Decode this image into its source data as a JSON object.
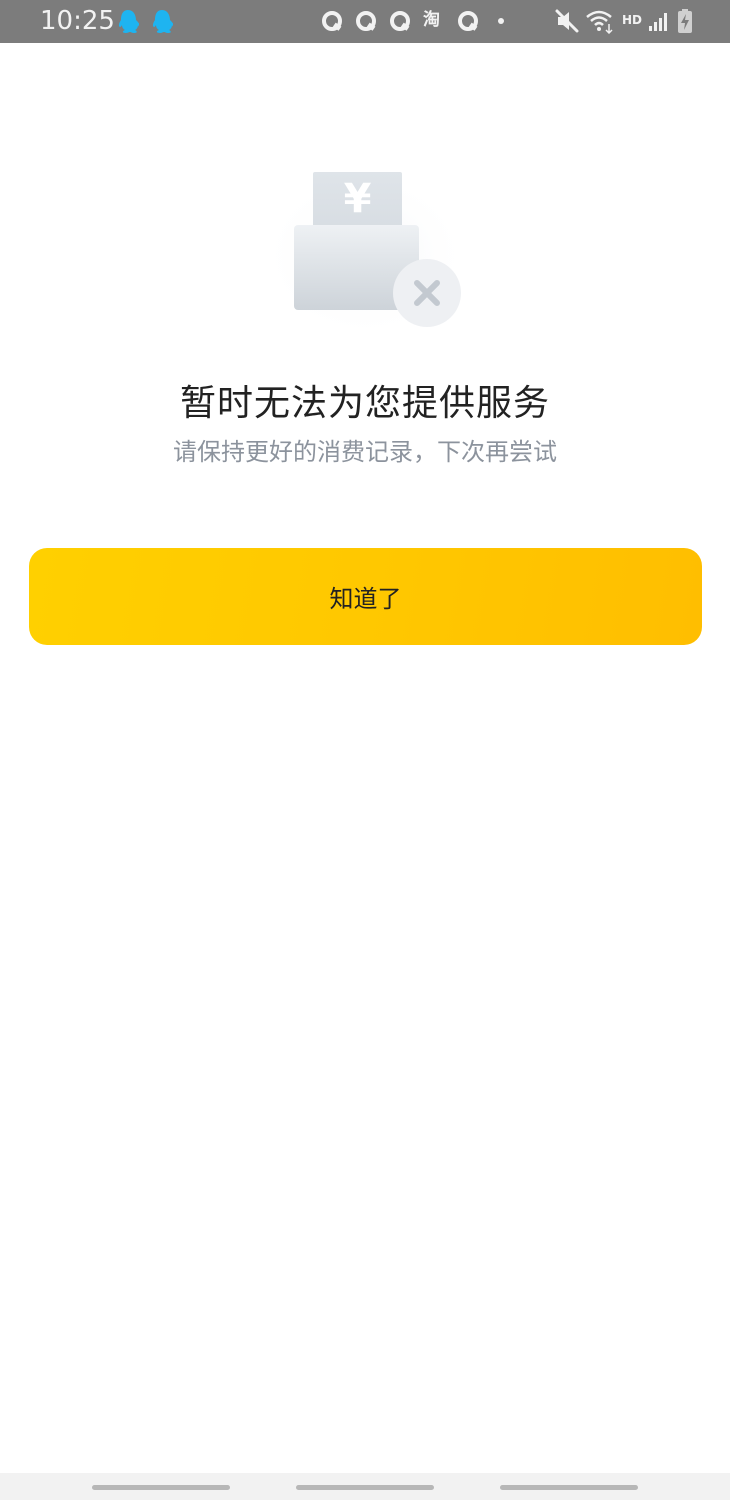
{
  "status_bar": {
    "time": "10:25",
    "left_icons": [
      "qq-icon",
      "qq-icon"
    ],
    "notification_icons": [
      "app-q-icon",
      "app-q-icon",
      "app-q-icon",
      "taobao-icon",
      "app-q-icon",
      "more-dot-icon"
    ],
    "taobao_glyph": "淘",
    "network_label": "HD",
    "right_icons": [
      "mute-icon",
      "wifi-icon",
      "signal-icon",
      "battery-charging-icon"
    ],
    "colors": {
      "background": "#7c7c7c",
      "qq_blue": "#1eb4f0"
    }
  },
  "main": {
    "illustration": "empty-wallet-error-icon",
    "illustration_glyph": "¥",
    "title": "暂时无法为您提供服务",
    "subtitle": "请保持更好的消费记录，下次再尝试",
    "button_label": "知道了"
  },
  "theme": {
    "button_gradient": [
      "#ffd000",
      "#ffbe00"
    ],
    "title_color": "#222222",
    "subtitle_color": "#8c939d"
  },
  "nav_bar": {
    "handles": [
      "nav-handle-left",
      "nav-handle-center",
      "nav-handle-right"
    ]
  }
}
